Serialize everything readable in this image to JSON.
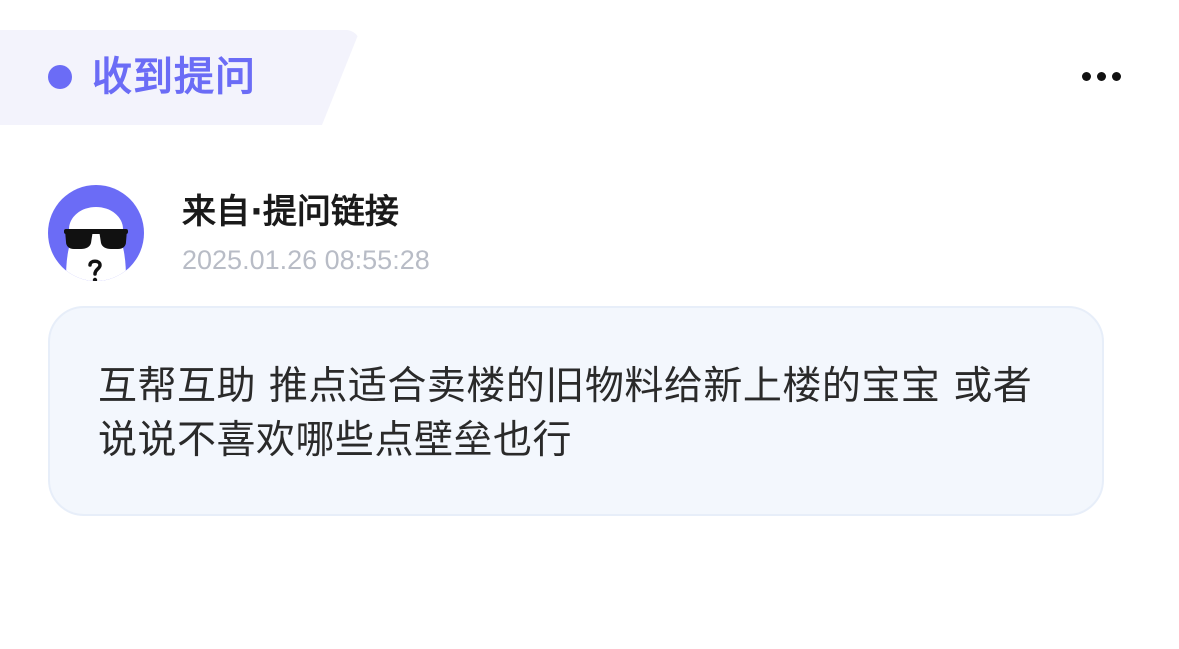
{
  "header": {
    "title": "收到提问",
    "accent_color": "#6b6cf6",
    "more_icon": "more-horizontal-icon"
  },
  "question": {
    "avatar_icon": "sunglasses-ghost-avatar",
    "sender": "来自·提问链接",
    "timestamp": "2025.01.26 08:55:28",
    "text": "互帮互助 推点适合卖楼的旧物料给新上楼的宝宝 或者说说不喜欢哪些点壁垒也行"
  }
}
